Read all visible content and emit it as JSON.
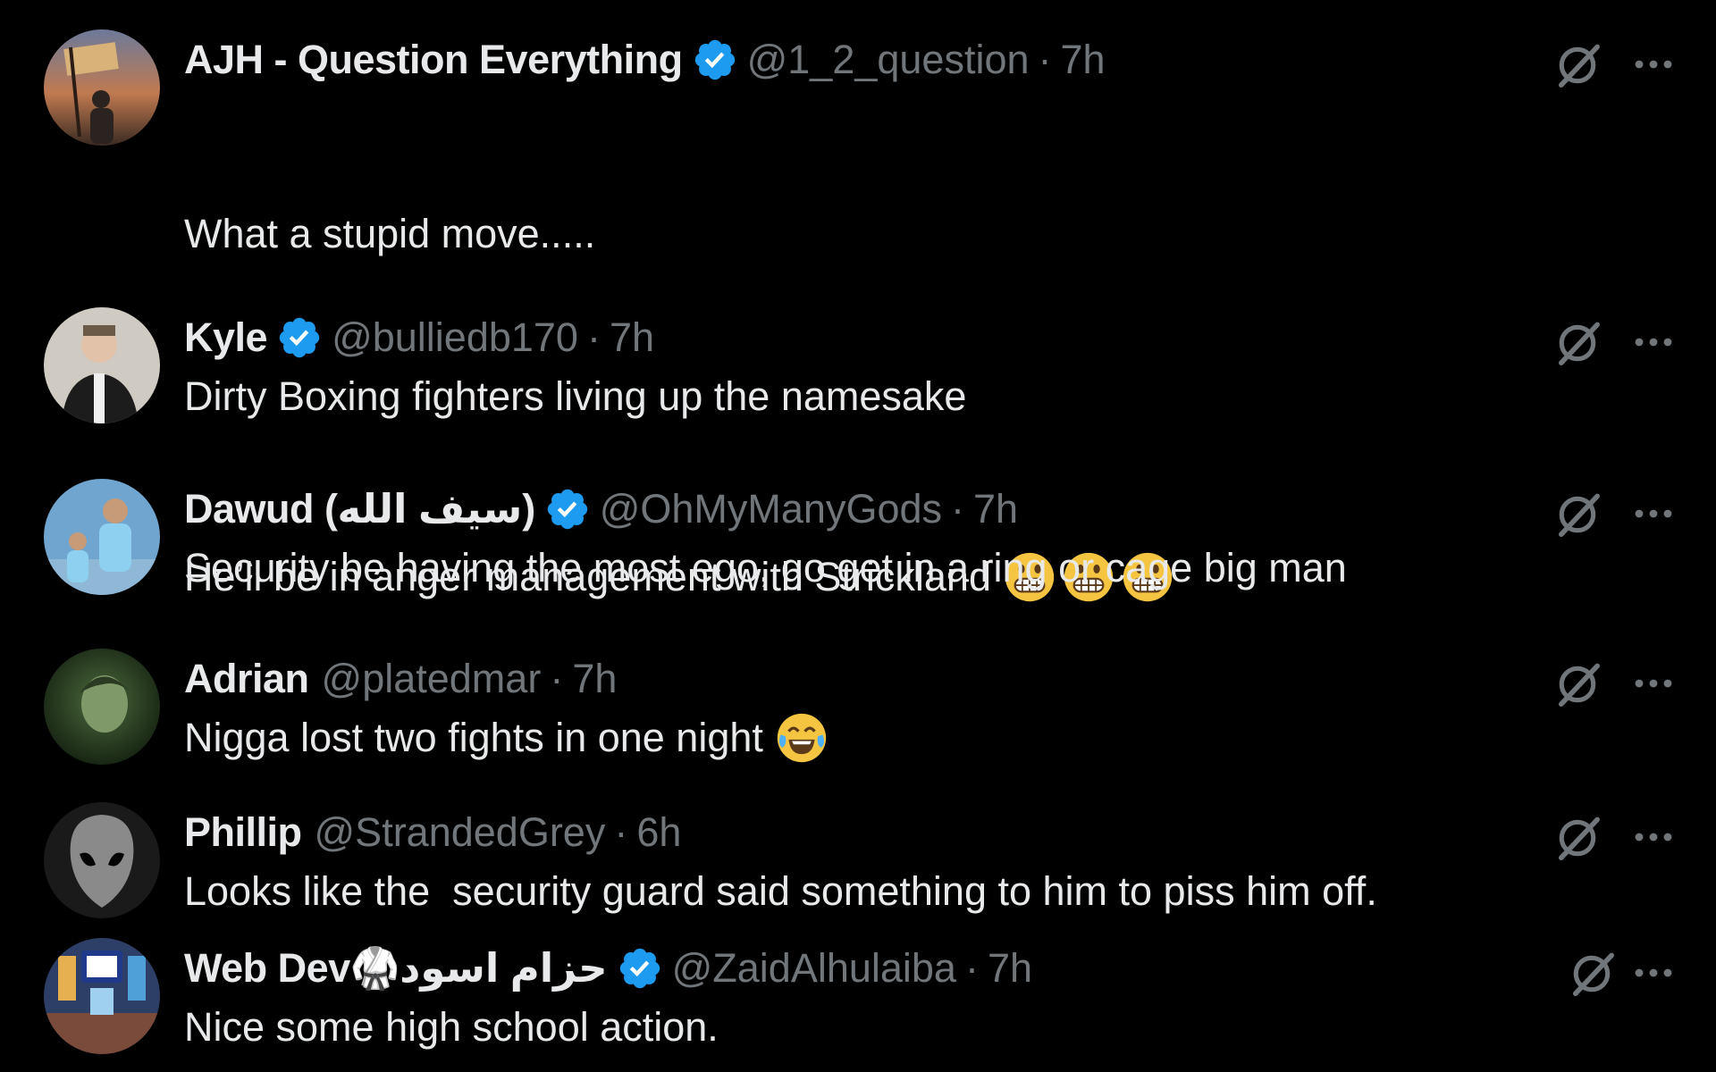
{
  "colors": {
    "background": "#000000",
    "text_primary": "#e7e9ea",
    "text_secondary": "#71767b",
    "verified_blue": "#1d9bf0",
    "emoji_yellow": "#f5c542"
  },
  "icons": {
    "verified": "verified-badge-icon",
    "grok": "grok-icon",
    "more": "more-options-icon",
    "grimace": "grimacing-face-emoji",
    "laugh": "face-with-tears-of-joy-emoji"
  },
  "replies": [
    {
      "name": "AJH - Question Everything",
      "verified": true,
      "handle": "@1_2_question",
      "sep": "·",
      "time": "7h",
      "line1": "What a stupid move.....",
      "line2": "He’ll be in anger management with Strickland"
    },
    {
      "name": "Kyle",
      "verified": true,
      "handle": "@bulliedb170",
      "sep": "·",
      "time": "7h",
      "text": "Dirty Boxing fighters living up the namesake"
    },
    {
      "name": "Dawud (سيف الله)",
      "verified": true,
      "handle": "@OhMyManyGods",
      "sep": "·",
      "time": "7h",
      "text": "Security be having the most ego, go get in a ring or cage big man"
    },
    {
      "name": "Adrian",
      "verified": false,
      "handle": "@platedmar",
      "sep": "·",
      "time": "7h",
      "text": "Nigga lost two fights in one night"
    },
    {
      "name": "Phillip",
      "verified": false,
      "handle": "@StrandedGrey",
      "sep": "·",
      "time": "6h",
      "text": "Looks like the  security guard said something to him to piss him off."
    },
    {
      "name": "Web Dev🥋حزام اسود",
      "verified": true,
      "handle": "@ZaidAlhulaiba",
      "sep": "·",
      "time": "7h",
      "text": "Nice some high school action."
    }
  ]
}
